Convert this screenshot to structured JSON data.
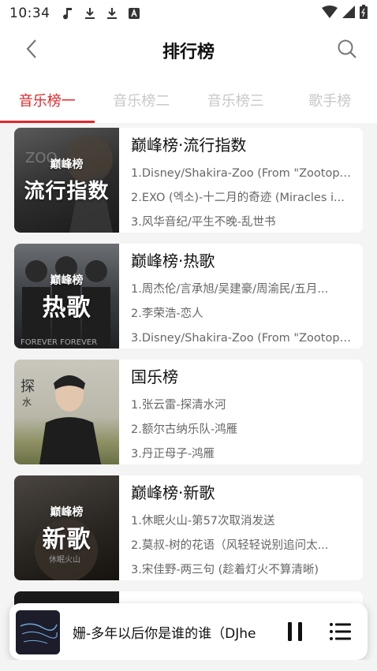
{
  "status_bar": {
    "time": "10:34",
    "icons": [
      "music-note-icon",
      "download-icon",
      "download-icon",
      "app-a-icon"
    ],
    "right_icons": [
      "wifi-icon",
      "signal-icon",
      "battery-icon"
    ]
  },
  "app_bar": {
    "title": "排行榜",
    "back_icon": "chevron-left-icon",
    "search_icon": "search-icon"
  },
  "tabs": [
    {
      "label": "音乐榜一",
      "active": true
    },
    {
      "label": "音乐榜二",
      "active": false
    },
    {
      "label": "音乐榜三",
      "active": false
    },
    {
      "label": "歌手榜",
      "active": false
    }
  ],
  "accent_color": "#e1282d",
  "charts": [
    {
      "name": "巅峰榜·流行指数",
      "cover_logo": "巅峰榜",
      "cover_text": "流行指数",
      "songs": [
        "1.Disney/Shakira-Zoo (From \"Zootopi...",
        "2.EXO (엑소)-十二月的奇迹 (Miracles i...",
        "3.风华音纪/平生不晚-乱世书"
      ]
    },
    {
      "name": "巅峰榜·热歌",
      "cover_logo": "巅峰榜",
      "cover_text": "热歌",
      "songs": [
        "1.周杰伦/言承旭/吴建豪/周渝民/五月...",
        "2.李荣浩-恋人",
        "3.Disney/Shakira-Zoo (From \"Zootopi..."
      ]
    },
    {
      "name": "国乐榜",
      "cover_logo": "",
      "cover_text": "",
      "songs": [
        "1.张云雷-探清水河",
        "2.额尔古纳乐队-鸿雁",
        "3.丹正母子-鸿雁"
      ]
    },
    {
      "name": "巅峰榜·新歌",
      "cover_logo": "巅峰榜",
      "cover_text": "新歌",
      "songs": [
        "1.休眠火山-第57次取消发送",
        "2.莫叔-树的花语（风轻轻说别追问太...",
        "3.宋佳野-两三句 (趁着灯火不算清晰)"
      ]
    }
  ],
  "player": {
    "now_playing": "姗-多年以后你是谁的谁（DJhe",
    "pause_icon": "pause-icon",
    "playlist_icon": "playlist-icon"
  }
}
